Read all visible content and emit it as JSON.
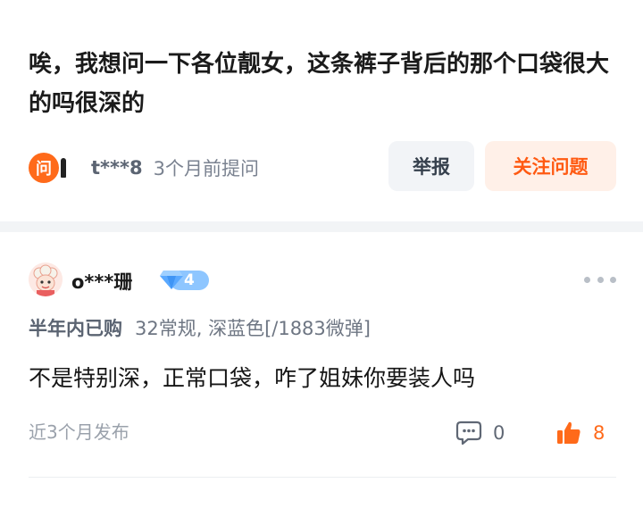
{
  "question": {
    "text": "唉，我想问一下各位靓女，这条裤子背后的那个口袋很大的吗很深的",
    "ask_icon_char": "问",
    "asker_name": "t***8",
    "asked_time": "3个月前提问"
  },
  "actions": {
    "report_label": "举报",
    "follow_label": "关注问题"
  },
  "answer": {
    "user_name": "o***珊",
    "level": "4",
    "purchase_tag": "半年内已购",
    "spec": "32常规, 深蓝色[/1883微弹]",
    "text": "不是特别深，正常口袋，咋了姐妹你要装人吗",
    "post_time": "近3个月发布",
    "comment_count": "0",
    "like_count": "8"
  },
  "colors": {
    "accent_orange": "#ff6a1a",
    "level_blue": "#6fb4ff",
    "muted_text": "#9aa1ab"
  },
  "icons": [
    "ask-icon",
    "avatar",
    "diamond-level-icon",
    "more-icon",
    "comment-icon",
    "thumbs-up-icon"
  ]
}
